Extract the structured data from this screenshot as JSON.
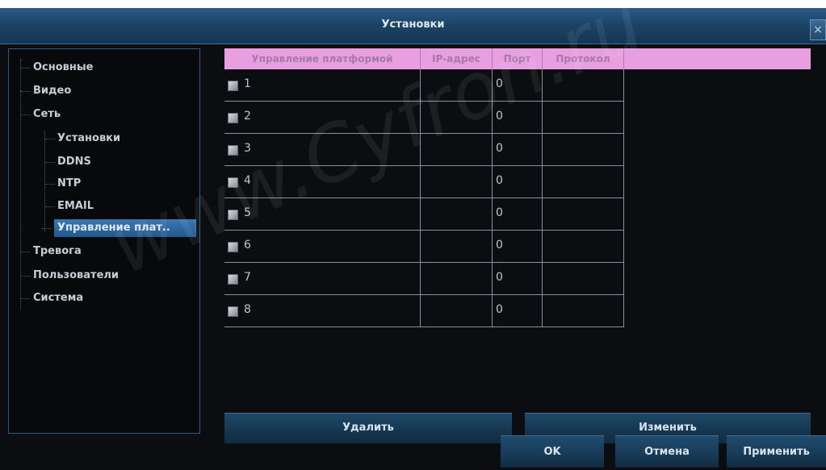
{
  "window": {
    "title": "Установки",
    "close_label": "×"
  },
  "sidebar": {
    "items": [
      {
        "label": "Основные"
      },
      {
        "label": "Видео"
      },
      {
        "label": "Сеть"
      },
      {
        "label": "Установки"
      },
      {
        "label": "DDNS"
      },
      {
        "label": "NTP"
      },
      {
        "label": "EMAIL"
      },
      {
        "label": "Управление плат..",
        "selected": true
      },
      {
        "label": "Тревога"
      },
      {
        "label": "Пользователи"
      },
      {
        "label": "Система"
      }
    ]
  },
  "table": {
    "columns": [
      "Управление платформой",
      "IP-адрес",
      "Порт",
      "Протокол"
    ],
    "rows": [
      {
        "num": "1",
        "ip": "",
        "port": "0",
        "protocol": "",
        "checked": false
      },
      {
        "num": "2",
        "ip": "",
        "port": "0",
        "protocol": "",
        "checked": false
      },
      {
        "num": "3",
        "ip": "",
        "port": "0",
        "protocol": "",
        "checked": false
      },
      {
        "num": "4",
        "ip": "",
        "port": "0",
        "protocol": "",
        "checked": false
      },
      {
        "num": "5",
        "ip": "",
        "port": "0",
        "protocol": "",
        "checked": false
      },
      {
        "num": "6",
        "ip": "",
        "port": "0",
        "protocol": "",
        "checked": false
      },
      {
        "num": "7",
        "ip": "",
        "port": "0",
        "protocol": "",
        "checked": false
      },
      {
        "num": "8",
        "ip": "",
        "port": "0",
        "protocol": "",
        "checked": false
      }
    ]
  },
  "actions": {
    "delete": "Удалить",
    "edit": "Изменить"
  },
  "footer": {
    "ok": "OK",
    "cancel": "Отмена",
    "apply": "Применить"
  },
  "watermark": "www.Cyfron.ru",
  "colors": {
    "header_bg": "#e79fe2",
    "title_bar": "#1c4467",
    "selection": "#2d68a0"
  }
}
